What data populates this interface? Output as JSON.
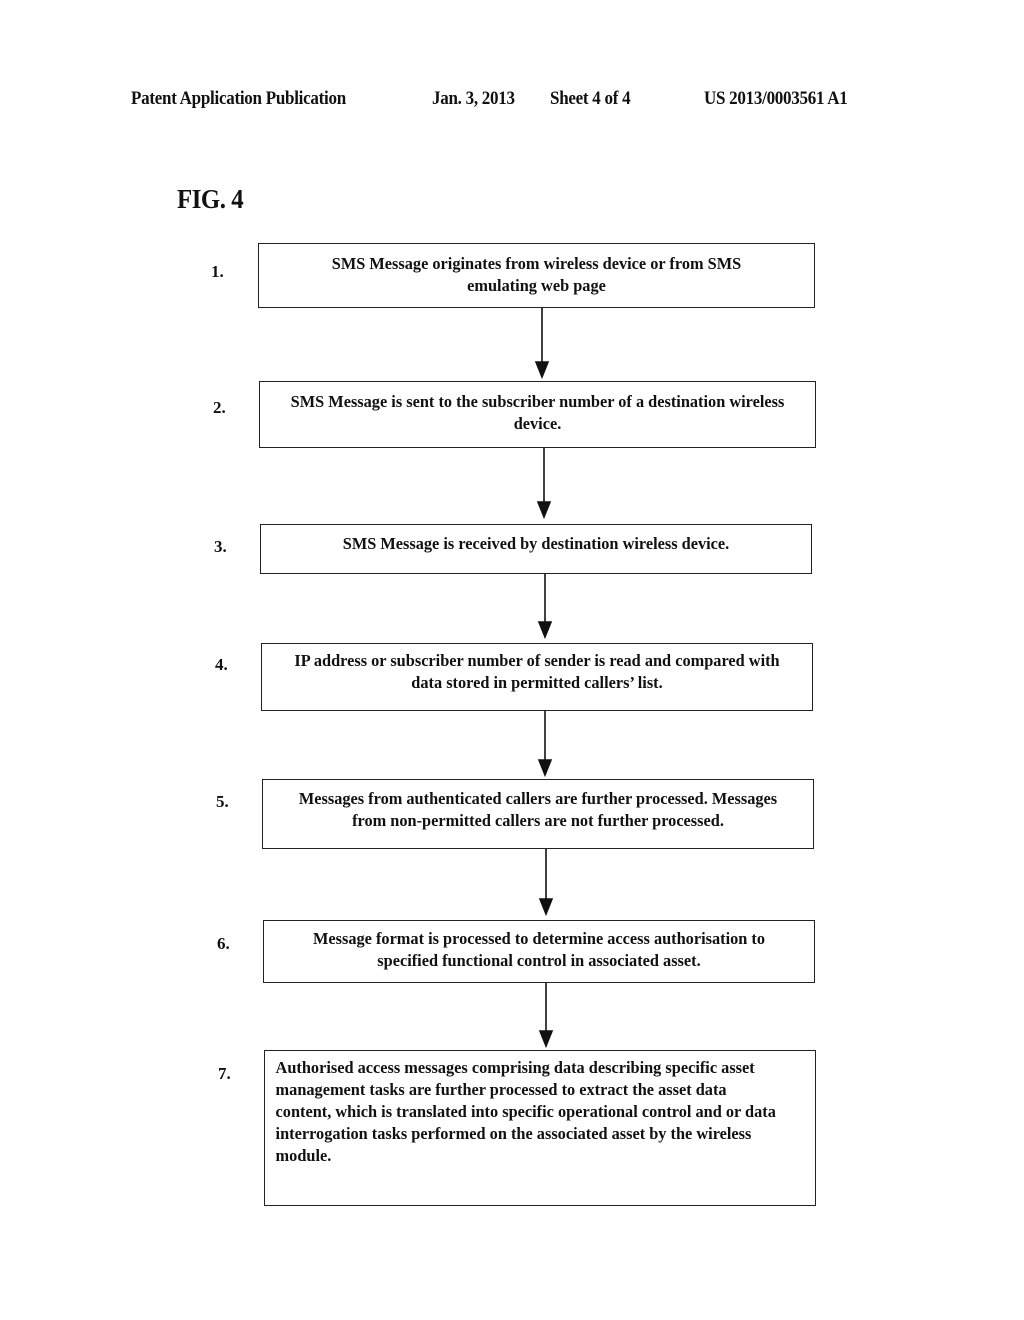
{
  "header": {
    "publication": "Patent Application Publication",
    "date": "Jan. 3, 2013",
    "sheet": "Sheet 4 of 4",
    "number": "US 2013/0003561 A1"
  },
  "figure": {
    "title": "FIG. 4"
  },
  "steps": [
    {
      "label": "1.",
      "text": "SMS Message originates from wireless device or from SMS emulating web page"
    },
    {
      "label": "2.",
      "text": "SMS Message is sent to the subscriber number of a destination wireless device."
    },
    {
      "label": "3.",
      "text": "SMS Message is received by destination wireless device."
    },
    {
      "label": "4.",
      "text": "IP address or subscriber number of sender is read and compared with data stored in permitted callers’ list."
    },
    {
      "label": "5.",
      "text": "Messages from authenticated callers are further processed. Messages from non-permitted callers are not further processed."
    },
    {
      "label": "6.",
      "text": "Message format is processed to determine access authorisation to specified functional control in associated asset."
    },
    {
      "label": "7.",
      "text": "Authorised access messages comprising data describing specific asset management tasks are further processed to extract the asset data content, which is translated into specific operational control and or data interrogation tasks performed on the associated asset by the wireless module."
    }
  ],
  "connections": [
    {
      "from": "1.",
      "to": "2."
    },
    {
      "from": "2.",
      "to": "3."
    },
    {
      "from": "3.",
      "to": "4."
    },
    {
      "from": "4.",
      "to": "5."
    },
    {
      "from": "5.",
      "to": "6."
    },
    {
      "from": "6.",
      "to": "7."
    }
  ]
}
